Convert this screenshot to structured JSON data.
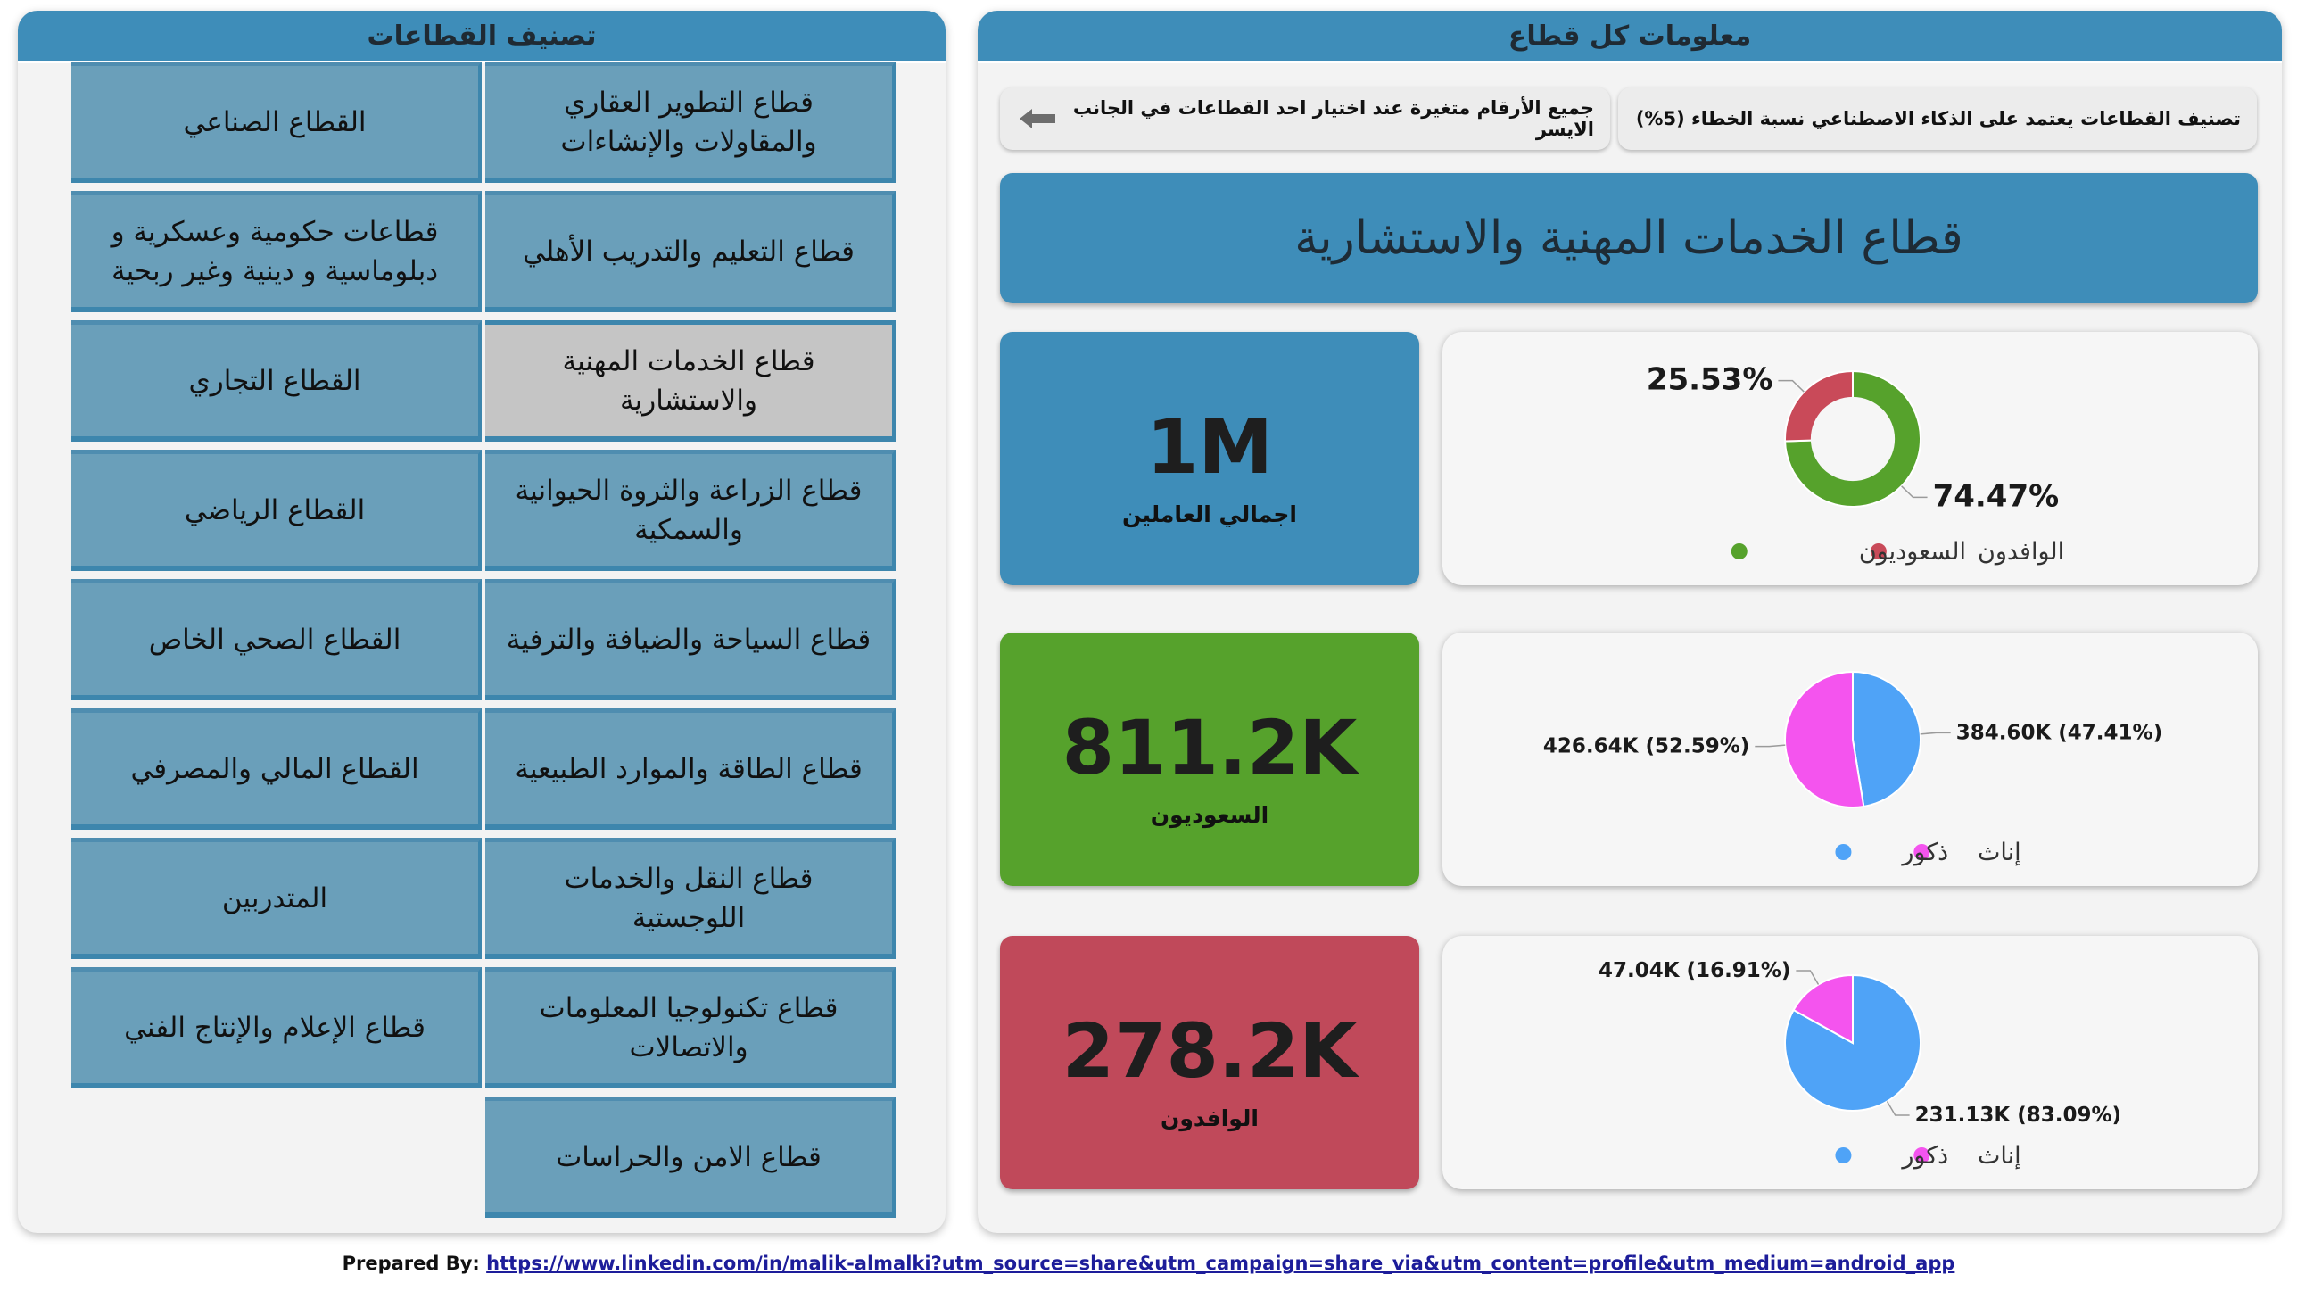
{
  "left_panel": {
    "title": "تصنيف القطاعات",
    "sectors": [
      {
        "label": "قطاع التطوير العقاري والمقاولات والإنشاءات",
        "selected": false
      },
      {
        "label": "القطاع الصناعي",
        "selected": false
      },
      {
        "label": "قطاع التعليم والتدريب الأهلي",
        "selected": false
      },
      {
        "label": "قطاعات حكومية وعسكرية و دبلوماسية و دينية وغير ربحية",
        "selected": false
      },
      {
        "label": "قطاع الخدمات المهنية والاستشارية",
        "selected": true
      },
      {
        "label": "القطاع التجاري",
        "selected": false
      },
      {
        "label": "قطاع الزراعة والثروة الحيوانية والسمكية",
        "selected": false
      },
      {
        "label": "القطاع الرياضي",
        "selected": false
      },
      {
        "label": "قطاع السياحة والضيافة والترفية",
        "selected": false
      },
      {
        "label": "القطاع الصحي الخاص",
        "selected": false
      },
      {
        "label": "قطاع الطاقة والموارد الطبيعية",
        "selected": false
      },
      {
        "label": "القطاع المالي والمصرفي",
        "selected": false
      },
      {
        "label": "قطاع النقل والخدمات اللوجستية",
        "selected": false
      },
      {
        "label": "المتدربين",
        "selected": false
      },
      {
        "label": "قطاع تكنولوجيا المعلومات والاتصالات",
        "selected": false
      },
      {
        "label": "قطاع الإعلام والإنتاج الفني",
        "selected": false
      },
      {
        "label": "قطاع الامن والحراسات",
        "selected": false
      }
    ]
  },
  "right_panel": {
    "title": "معلومات كل قطاع",
    "note_ai": "تصنيف القطاعات يعتمد على الذكاء الاصطناعي  نسبة الخطاء (5%)",
    "note_dynamic": "جميع الأرقام متغيرة عند اختيار احد القطاعات في الجانب الايسر",
    "arrow_icon": "arrow-left-icon",
    "selected_sector": "قطاع الخدمات المهنية والاستشارية",
    "kpis": [
      {
        "value": "1M",
        "label": "اجمالي العاملين",
        "color": "#3e8db9"
      },
      {
        "value": "811.2K",
        "label": "السعوديون",
        "color": "#56a22c"
      },
      {
        "value": "278.2K",
        "label": "الوافدون",
        "color": "#c0495a"
      }
    ]
  },
  "chart_data": [
    {
      "type": "pie",
      "donut": true,
      "labels": [
        "السعوديون",
        "الوافدون"
      ],
      "values": [
        74.47,
        25.53
      ],
      "value_labels": [
        "74.47%",
        "25.53%"
      ],
      "colors": [
        "#56a22c",
        "#c94a59"
      ],
      "legend": [
        "الوافدون",
        "السعوديون"
      ],
      "legend_colors": [
        "#c94a59",
        "#56a22c"
      ]
    },
    {
      "type": "pie",
      "labels": [
        "ذكور",
        "إناث"
      ],
      "values": [
        384.6,
        426.64
      ],
      "value_labels": [
        "384.60K (47.41%)",
        "426.64K (52.59%)"
      ],
      "colors": [
        "#4fa3f7",
        "#f454ee"
      ],
      "legend": [
        "إناث",
        "ذكور"
      ],
      "legend_colors": [
        "#f454ee",
        "#4fa3f7"
      ]
    },
    {
      "type": "pie",
      "labels": [
        "ذكور",
        "إناث"
      ],
      "values": [
        231.13,
        47.04
      ],
      "value_labels": [
        "231.13K (83.09%)",
        "47.04K (16.91%)"
      ],
      "colors": [
        "#4fa3f7",
        "#f454ee"
      ],
      "legend": [
        "إناث",
        "ذكور"
      ],
      "legend_colors": [
        "#f454ee",
        "#4fa3f7"
      ]
    }
  ],
  "footer": {
    "prefix": "Prepared By:",
    "link": "https://www.linkedin.com/in/malik-almalki?utm_source=share&utm_campaign=share_via&utm_content=profile&utm_medium=android_app"
  }
}
